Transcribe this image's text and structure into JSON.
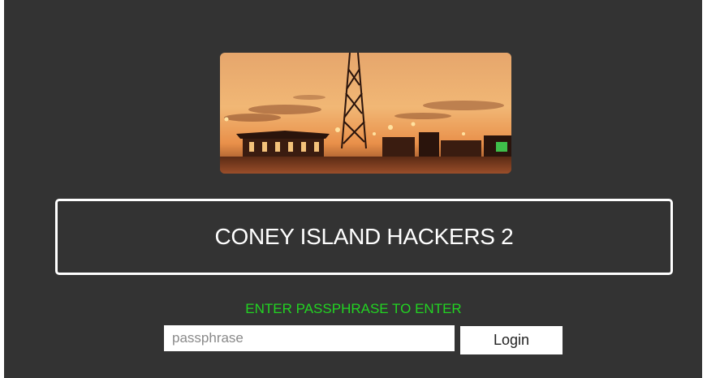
{
  "site": {
    "title": "CONEY ISLAND HACKERS 2"
  },
  "hero": {
    "icon": "coney-island-sunset-photo"
  },
  "login": {
    "prompt": "ENTER PASSPHRASE TO ENTER",
    "input_placeholder": "passphrase",
    "input_value": "",
    "button_label": "Login"
  },
  "colors": {
    "background": "#333333",
    "prompt": "#22d422",
    "border": "#ffffff"
  }
}
